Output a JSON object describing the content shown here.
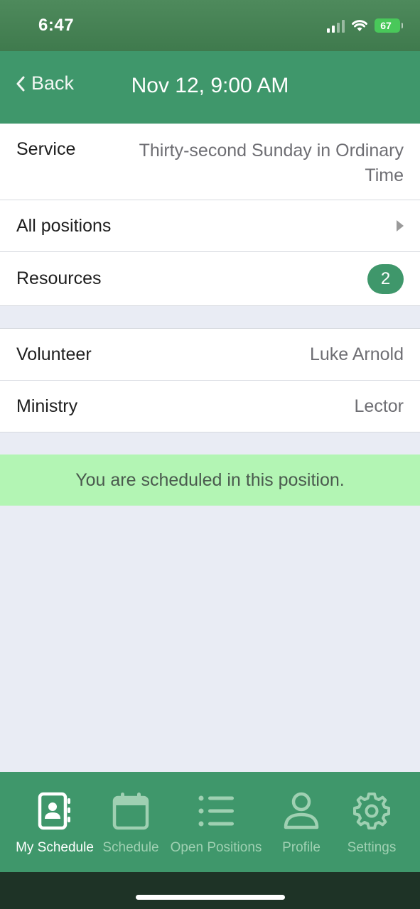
{
  "status_bar": {
    "time": "6:47",
    "battery": "67"
  },
  "nav": {
    "back_label": "Back",
    "title": "Nov 12, 9:00 AM"
  },
  "details": {
    "service_label": "Service",
    "service_value": "Thirty-second Sunday in Ordinary Time",
    "all_positions_label": "All positions",
    "resources_label": "Resources",
    "resources_count": "2"
  },
  "assignment": {
    "volunteer_label": "Volunteer",
    "volunteer_value": "Luke Arnold",
    "ministry_label": "Ministry",
    "ministry_value": "Lector"
  },
  "notice": "You are scheduled in this position.",
  "tabs": [
    {
      "label": "My Schedule",
      "icon": "contact-book-icon",
      "active": true
    },
    {
      "label": "Schedule",
      "icon": "calendar-icon",
      "active": false
    },
    {
      "label": "Open Positions",
      "icon": "list-icon",
      "active": false
    },
    {
      "label": "Profile",
      "icon": "person-icon",
      "active": false
    },
    {
      "label": "Settings",
      "icon": "gear-icon",
      "active": false
    }
  ],
  "colors": {
    "brand": "#3f976b",
    "notice_bg": "#b3f5b4",
    "background": "#e9ecf4"
  }
}
